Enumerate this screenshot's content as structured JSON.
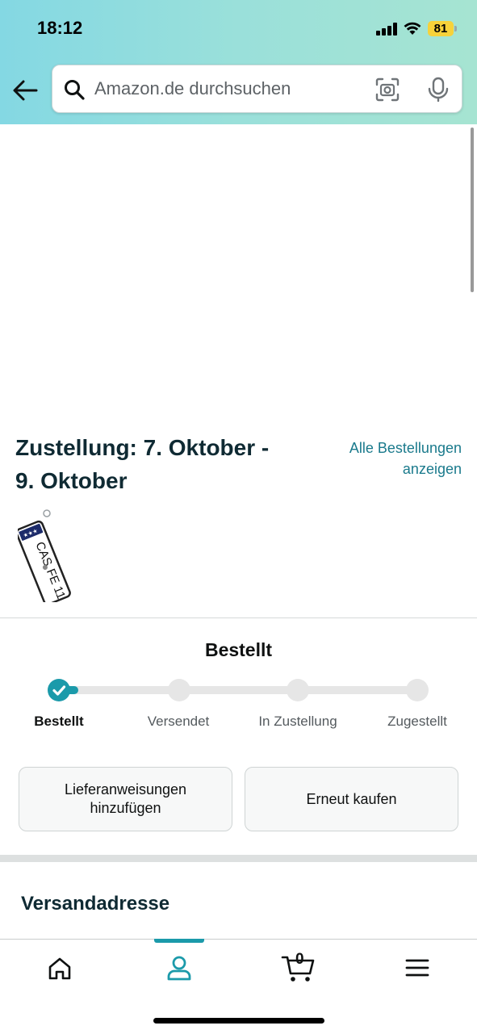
{
  "status_bar": {
    "time": "18:12",
    "battery": "81"
  },
  "search": {
    "placeholder": "Amazon.de durchsuchen"
  },
  "delivery": {
    "title": "Zustellung: 7. Oktober - 9. Oktober",
    "all_orders_link": "Alle Bestellungen anzeigen"
  },
  "product": {
    "plate_text_top": "CAS",
    "plate_text_bottom": "FE 11"
  },
  "tracking": {
    "current_status": "Bestellt",
    "steps": [
      "Bestellt",
      "Versendet",
      "In Zustellung",
      "Zugestellt"
    ],
    "completed_steps": 1
  },
  "actions": {
    "delivery_instructions": "Lieferanweisungen hinzufügen",
    "buy_again": "Erneut kaufen"
  },
  "shipping": {
    "section_title": "Versandadresse"
  },
  "tabbar": {
    "cart_count": "0",
    "active_tab": "account"
  },
  "colors": {
    "accent": "#1b9aaa",
    "header_gradient_start": "#84d8e3",
    "header_gradient_end": "#a6e4d2",
    "link": "#1a7a8c",
    "battery": "#f7d23a"
  }
}
